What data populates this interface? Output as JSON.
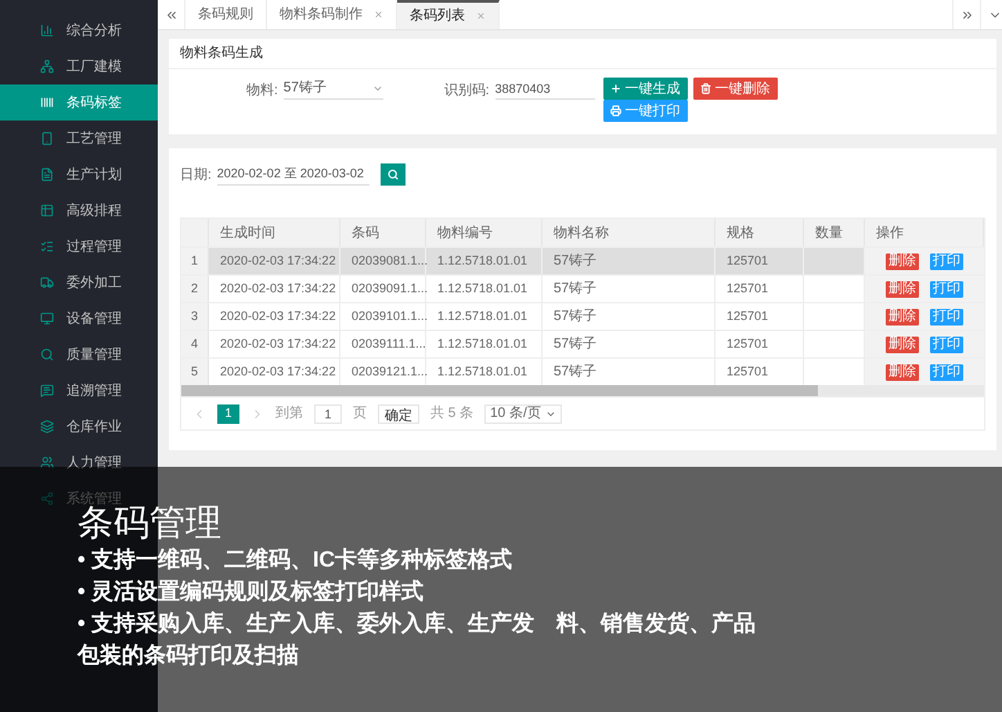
{
  "sidebar": {
    "items": [
      {
        "label": "综合分析",
        "selected": false
      },
      {
        "label": "工厂建模",
        "selected": false
      },
      {
        "label": "条码标签",
        "selected": true
      },
      {
        "label": "工艺管理",
        "selected": false
      },
      {
        "label": "生产计划",
        "selected": false
      },
      {
        "label": "高级排程",
        "selected": false
      },
      {
        "label": "过程管理",
        "selected": false
      },
      {
        "label": "委外加工",
        "selected": false
      },
      {
        "label": "设备管理",
        "selected": false
      },
      {
        "label": "质量管理",
        "selected": false
      },
      {
        "label": "追溯管理",
        "selected": false
      },
      {
        "label": "仓库作业",
        "selected": false
      },
      {
        "label": "人力管理",
        "selected": false
      },
      {
        "label": "系统管理",
        "selected": false
      }
    ]
  },
  "tabs": [
    {
      "label": "条码规则",
      "selected": false,
      "closable": false
    },
    {
      "label": "物料条码制作",
      "selected": false,
      "closable": true
    },
    {
      "label": "条码列表",
      "selected": true,
      "closable": true
    }
  ],
  "generate_panel": {
    "title": "物料条码生成",
    "material_label": "物料:",
    "material_value": "57铸子",
    "code_label": "识别码:",
    "code_value": "38870403",
    "buttons": [
      {
        "label": "一键生成",
        "kind": "generate"
      },
      {
        "label": "一键删除",
        "kind": "delete"
      },
      {
        "label": "一键打印",
        "kind": "print"
      }
    ]
  },
  "list_panel": {
    "date_label": "日期:",
    "date_value": "2020-02-02 至 2020-03-02",
    "table": {
      "columns": [
        "生成时间",
        "条码",
        "物料编号",
        "物料名称",
        "规格",
        "数量",
        "操作"
      ],
      "rows": [
        {
          "index": "1",
          "time": "2020-02-03 17:34:22",
          "barcode": "02039081.1...",
          "material_no": "1.12.5718.01.01",
          "material_name": "57铸子",
          "spec": "125701",
          "selected": true,
          "actions": [
            "删除",
            "打印"
          ]
        },
        {
          "index": "2",
          "time": "2020-02-03 17:34:22",
          "barcode": "02039091.1...",
          "material_no": "1.12.5718.01.01",
          "material_name": "57铸子",
          "spec": "125701",
          "selected": false,
          "actions": [
            "删除",
            "打印"
          ]
        },
        {
          "index": "3",
          "time": "2020-02-03 17:34:22",
          "barcode": "02039101.1...",
          "material_no": "1.12.5718.01.01",
          "material_name": "57铸子",
          "spec": "125701",
          "selected": false,
          "actions": [
            "删除",
            "打印"
          ]
        },
        {
          "index": "4",
          "time": "2020-02-03 17:34:22",
          "barcode": "02039111.1...",
          "material_no": "1.12.5718.01.01",
          "material_name": "57铸子",
          "spec": "125701",
          "selected": false,
          "actions": [
            "删除",
            "打印"
          ]
        },
        {
          "index": "5",
          "time": "2020-02-03 17:34:22",
          "barcode": "02039121.1...",
          "material_no": "1.12.5718.01.01",
          "material_name": "57铸子",
          "spec": "125701",
          "selected": false,
          "actions": [
            "删除",
            "打印"
          ]
        }
      ]
    },
    "pagination": {
      "current": "1",
      "goto_label": "到第",
      "goto_value": "1",
      "page_label": "页",
      "confirm": "确定",
      "total": "共 5 条",
      "page_size": "10 条/页"
    }
  },
  "caption": {
    "title": "条码管理",
    "bullets": [
      "• 支持一维码、二维码、IC卡等多种标签格式",
      "• 灵活设置编码规则及标签打印样式",
      "• 支持采购入库、生产入库、委外入库、生产发　料、销售发货、产品包装的条码打印及扫描"
    ]
  }
}
